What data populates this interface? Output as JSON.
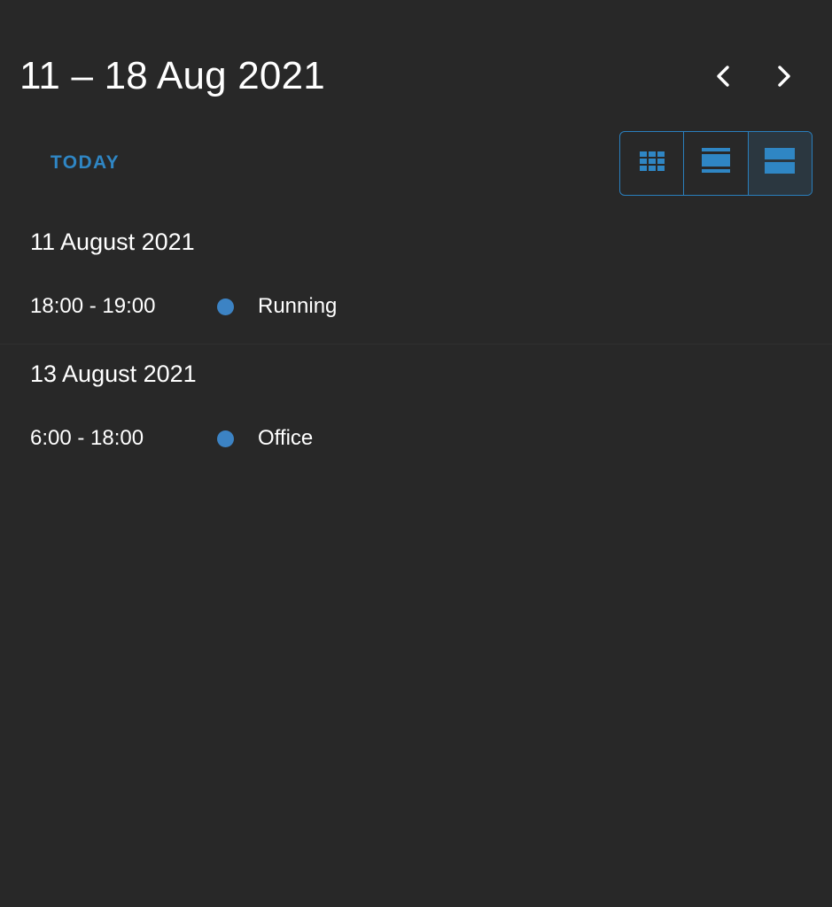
{
  "header": {
    "range_title": "11 – 18 Aug 2021",
    "prev_icon": "chevron-left-icon",
    "next_icon": "chevron-right-icon"
  },
  "toolbar": {
    "today_label": "TODAY",
    "views": [
      {
        "icon": "month-grid-icon",
        "active": false
      },
      {
        "icon": "week-list-icon",
        "active": false
      },
      {
        "icon": "day-list-icon",
        "active": true
      }
    ]
  },
  "days": [
    {
      "heading": "11 August 2021",
      "events": [
        {
          "time": "18:00 - 19:00",
          "title": "Running",
          "color": "#3c83c4"
        }
      ]
    },
    {
      "heading": "13 August 2021",
      "events": [
        {
          "time": "6:00 - 18:00",
          "title": "Office",
          "color": "#3c83c4"
        }
      ]
    }
  ],
  "colors": {
    "background": "#282828",
    "accent": "#2f86c4",
    "text": "#ffffff"
  }
}
